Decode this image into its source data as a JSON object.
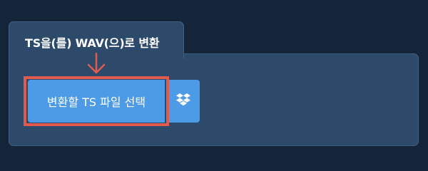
{
  "tab": {
    "title": "TS을(를) WAV(으)로 변환"
  },
  "upload": {
    "select_label": "변환할 TS 파일 선택",
    "dropbox_icon": "dropbox-icon"
  },
  "colors": {
    "background": "#14253a",
    "panel": "#2d4a6b",
    "button": "#4d9be6",
    "highlight": "#e05a50"
  }
}
